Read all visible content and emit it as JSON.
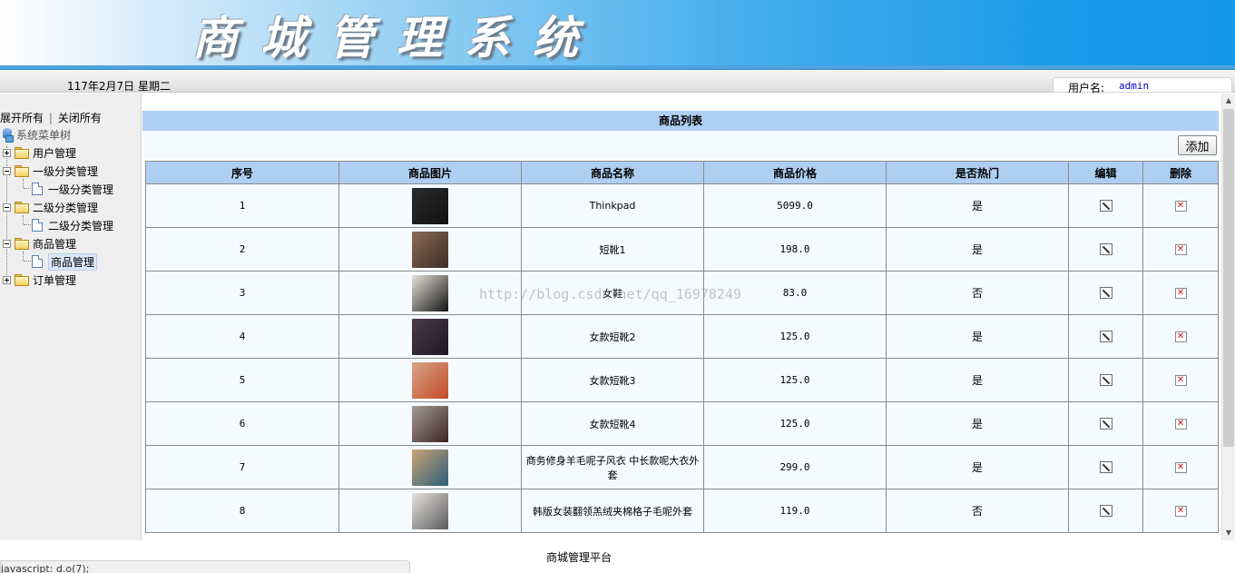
{
  "banner": {
    "title": "商城管理系统"
  },
  "info_bar": {
    "date": "117年2月7日 星期二",
    "user_label": "用户名:",
    "user_value": "admin"
  },
  "sidebar": {
    "expand_all": "展开所有",
    "separator": "|",
    "collapse_all": "关闭所有",
    "root": "系统菜单树",
    "nodes": [
      {
        "label": "用户管理",
        "state": "collapsed"
      },
      {
        "label": "一级分类管理",
        "state": "expanded",
        "children": [
          "一级分类管理"
        ]
      },
      {
        "label": "二级分类管理",
        "state": "expanded",
        "children": [
          "二级分类管理"
        ]
      },
      {
        "label": "商品管理",
        "state": "expanded",
        "children": [
          "商品管理"
        ],
        "selected_child": "商品管理"
      },
      {
        "label": "订单管理",
        "state": "collapsed"
      }
    ]
  },
  "main": {
    "title": "商品列表",
    "add_label": "添加",
    "columns": [
      "序号",
      "商品图片",
      "商品名称",
      "商品价格",
      "是否热门",
      "编辑",
      "删除"
    ],
    "rows": [
      {
        "no": "1",
        "name": "Thinkpad",
        "price": "5099.0",
        "hot": "是",
        "thumb": [
          "#2b2b2b",
          "#111111"
        ]
      },
      {
        "no": "2",
        "name": "短靴1",
        "price": "198.0",
        "hot": "是",
        "thumb": [
          "#8c6a55",
          "#3b2d26"
        ]
      },
      {
        "no": "3",
        "name": "女鞋",
        "price": "83.0",
        "hot": "否",
        "thumb": [
          "#e7e2d9",
          "#141414"
        ]
      },
      {
        "no": "4",
        "name": "女款短靴2",
        "price": "125.0",
        "hot": "是",
        "thumb": [
          "#4c3a4c",
          "#1d1722"
        ]
      },
      {
        "no": "5",
        "name": "女款短靴3",
        "price": "125.0",
        "hot": "是",
        "thumb": [
          "#d9a48a",
          "#c34a24"
        ]
      },
      {
        "no": "6",
        "name": "女款短靴4",
        "price": "125.0",
        "hot": "是",
        "thumb": [
          "#a59b96",
          "#3a2520"
        ]
      },
      {
        "no": "7",
        "name": "商务修身羊毛呢子风衣 中长款呢大衣外套",
        "price": "299.0",
        "hot": "是",
        "thumb": [
          "#c9a476",
          "#2f5d7a"
        ]
      },
      {
        "no": "8",
        "name": "韩版女装翻领羔绒夹棉格子毛呢外套",
        "price": "119.0",
        "hot": "否",
        "thumb": [
          "#e6e3e0",
          "#5a5a5a"
        ]
      }
    ],
    "watermark": "http://blog.csdn.net/qq_16978249"
  },
  "footer": {
    "text": "商城管理平台"
  },
  "statusbar": {
    "text": "javascript: d.o(7);"
  },
  "colors": {
    "header_blue": "#aecff2",
    "row_bg": "#f5faff",
    "banner_blue": "#149ae9"
  }
}
